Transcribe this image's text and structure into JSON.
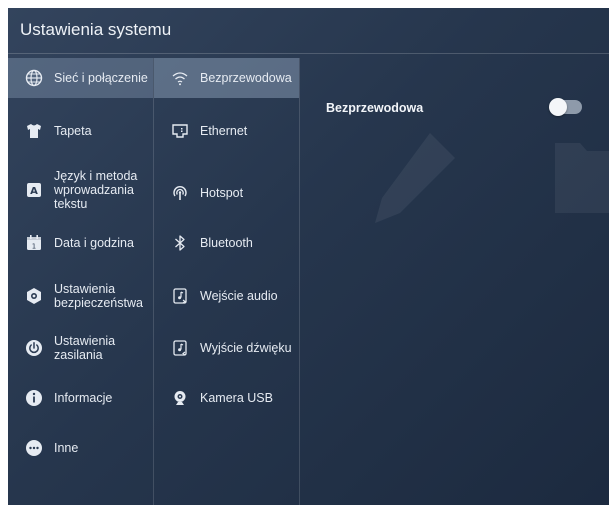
{
  "window": {
    "title": "Ustawienia systemu"
  },
  "categories": [
    {
      "label": "Sieć i połączenie",
      "icon": "globe-icon"
    },
    {
      "label": "Tapeta",
      "icon": "shirt-icon"
    },
    {
      "label": "Język i metoda wprowadzania tekstu",
      "icon": "keyboard-a-icon"
    },
    {
      "label": "Data i godzina",
      "icon": "calendar-icon"
    },
    {
      "label": "Ustawienia bezpieczeństwa",
      "icon": "shield-icon"
    },
    {
      "label": "Ustawienia zasilania",
      "icon": "power-icon"
    },
    {
      "label": "Informacje",
      "icon": "info-icon"
    },
    {
      "label": "Inne",
      "icon": "more-icon"
    }
  ],
  "subcategories": [
    {
      "label": "Bezprzewodowa",
      "icon": "wifi-icon"
    },
    {
      "label": "Ethernet",
      "icon": "ethernet-icon"
    },
    {
      "label": "Hotspot",
      "icon": "hotspot-icon"
    },
    {
      "label": "Bluetooth",
      "icon": "bluetooth-icon"
    },
    {
      "label": "Wejście audio",
      "icon": "audio-in-icon"
    },
    {
      "label": "Wyjście dźwięku",
      "icon": "audio-out-icon"
    },
    {
      "label": "Kamera USB",
      "icon": "webcam-icon"
    }
  ],
  "content": {
    "setting_label": "Bezprzewodowa",
    "toggle_state": "off"
  },
  "colors": {
    "background": "#26364d",
    "active_item": "#5d6f86",
    "toggle_track": "#8e9aaa",
    "toggle_knob": "#f4f6f9"
  }
}
